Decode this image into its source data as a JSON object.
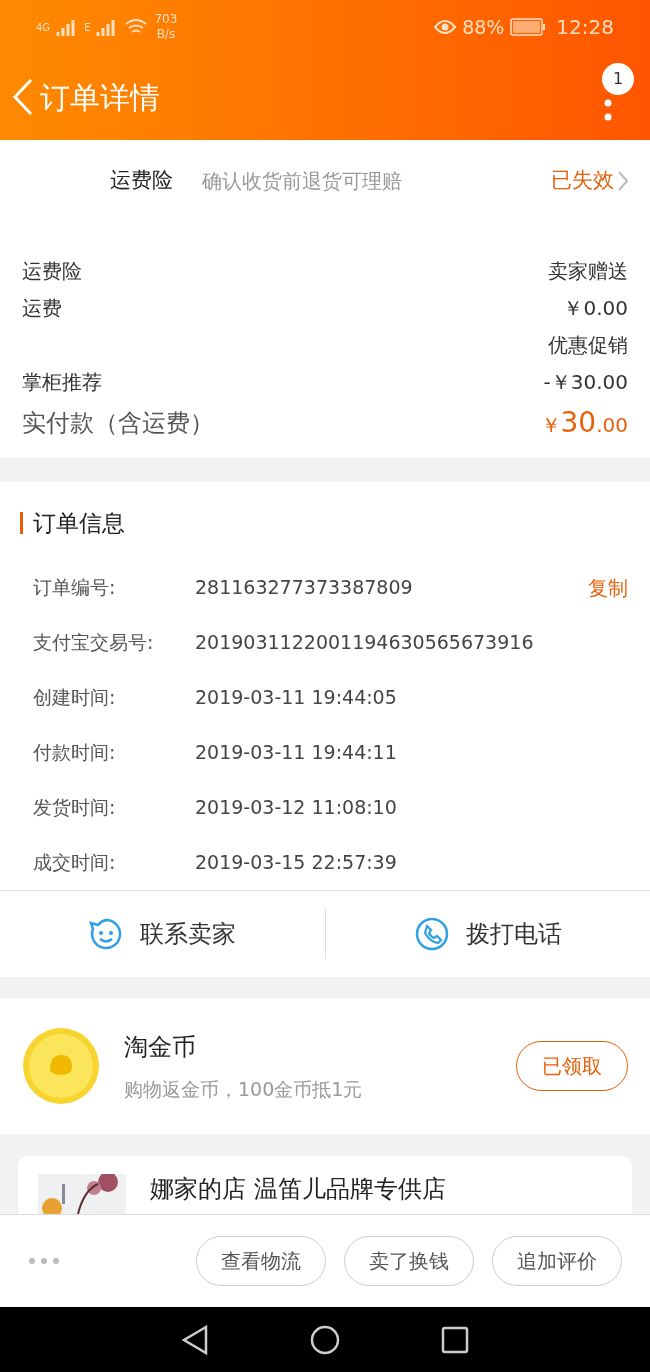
{
  "status_bar": {
    "network_1": "4G",
    "network_2": "E",
    "speed_value": "703",
    "speed_unit": "B/s",
    "battery": "88%",
    "time": "12:28"
  },
  "header": {
    "title": "订单详情",
    "badge": "1"
  },
  "insurance": {
    "label": "运费险",
    "description": "确认收货前退货可理赔",
    "status": "已失效"
  },
  "price_rows": [
    {
      "label": "运费险",
      "value": "卖家赠送"
    },
    {
      "label": "运费",
      "value": "￥0.00"
    },
    {
      "label": "",
      "value": "优惠促销"
    },
    {
      "label": "掌柜推荐",
      "value": "-￥30.00"
    }
  ],
  "total": {
    "label": "实付款（含运费）",
    "currency": "￥",
    "integer": "30",
    "decimal": ".00"
  },
  "order_info": {
    "title": "订单信息",
    "rows": [
      {
        "label": "订单编号:",
        "value": "281163277373387809",
        "action": "复制"
      },
      {
        "label": "支付宝交易号:",
        "value": "2019031122001194630565673916"
      },
      {
        "label": "创建时间:",
        "value": "2019-03-11 19:44:05"
      },
      {
        "label": "付款时间:",
        "value": "2019-03-11 19:44:11"
      },
      {
        "label": "发货时间:",
        "value": "2019-03-12 11:08:10"
      },
      {
        "label": "成交时间:",
        "value": "2019-03-15 22:57:39"
      }
    ]
  },
  "contact": [
    {
      "kind": "chat",
      "label": "联系卖家"
    },
    {
      "kind": "phone",
      "label": "拨打电话"
    }
  ],
  "coins": {
    "title": "淘金币",
    "subtitle": "购物返金币，100金币抵1元",
    "button": "已领取"
  },
  "shop": {
    "name": "娜家的店 温笛儿品牌专供店"
  },
  "bottom_buttons": [
    "查看物流",
    "卖了换钱",
    "追加评价"
  ]
}
